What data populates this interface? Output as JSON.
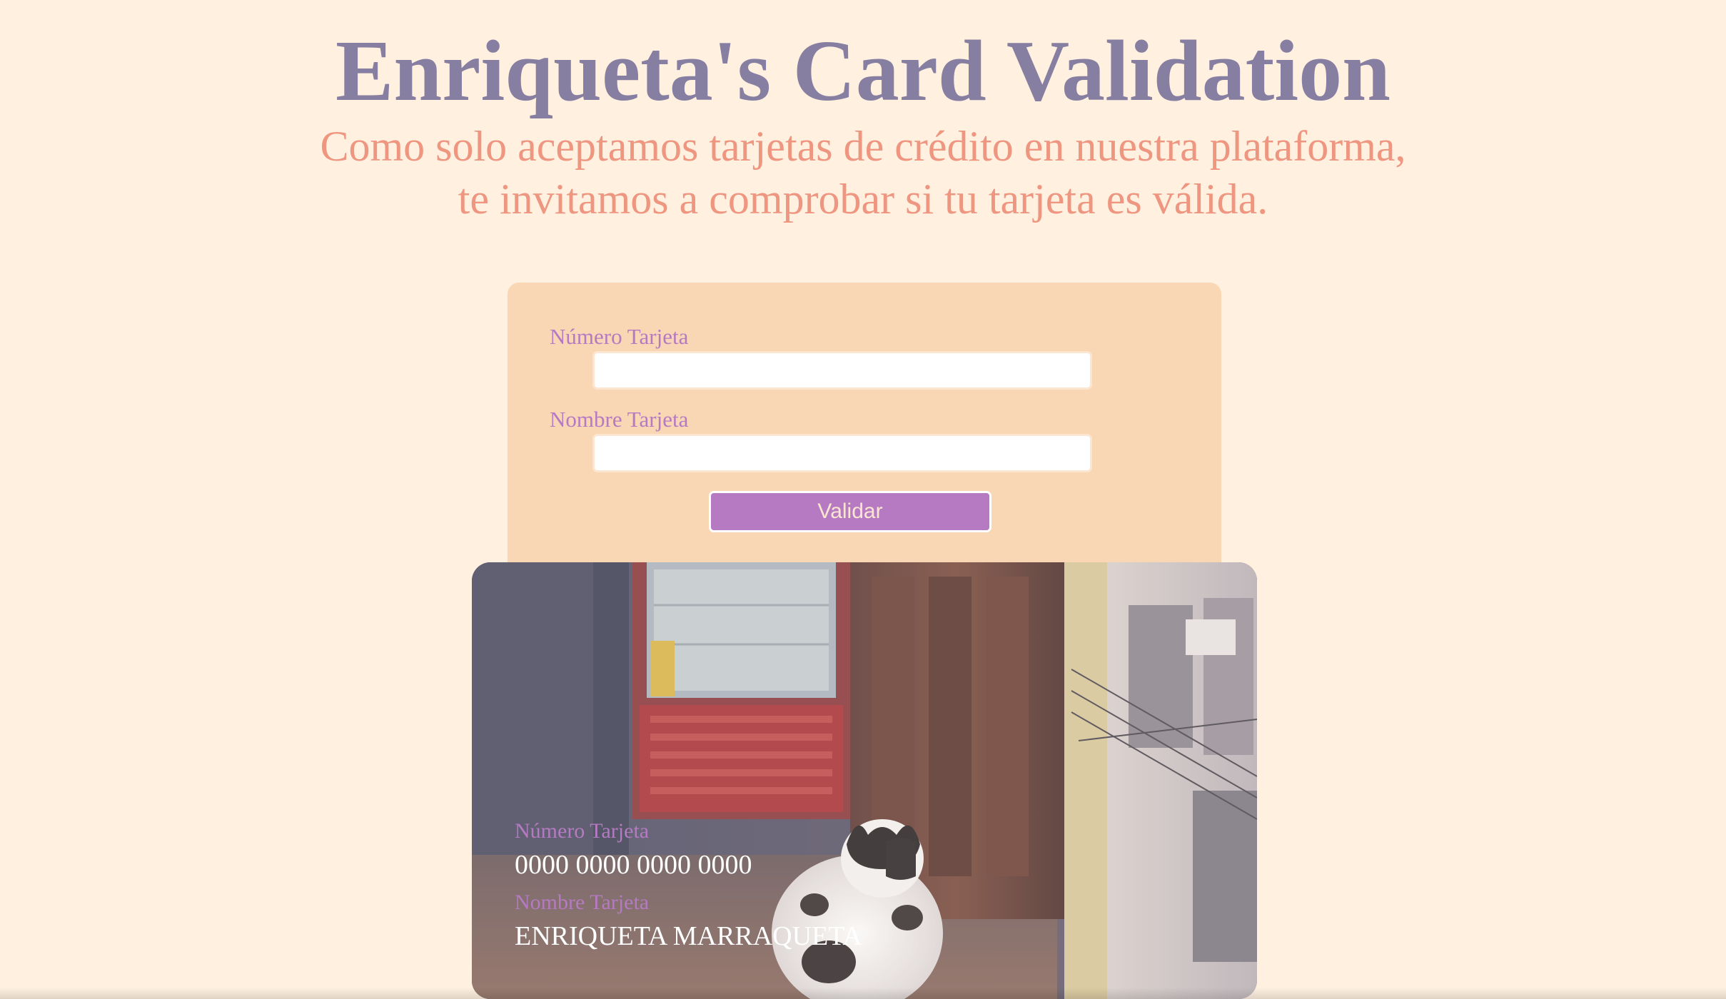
{
  "page": {
    "title": "Enriqueta's Card Validation",
    "subtitle_lines": [
      "Como solo aceptamos tarjetas de crédito en nuestra plataforma,",
      "te invitamos a comprobar si tu tarjeta es válida."
    ]
  },
  "form": {
    "card_number_label": "Número Tarjeta",
    "card_number_value": "",
    "card_name_label": "Nombre Tarjeta",
    "card_name_value": "",
    "validate_label": "Validar"
  },
  "card_preview": {
    "number_label": "Número Tarjeta",
    "number_value": "0000 0000 0000 0000",
    "name_label": "Nombre Tarjeta",
    "name_value": "ENRIQUETA MARRAQUETA"
  },
  "colors": {
    "background": "#fff0e0",
    "title": "#877fa1",
    "subtitle": "#ee9680",
    "panel": "#f9d7b5",
    "accent": "#b57ac2"
  }
}
